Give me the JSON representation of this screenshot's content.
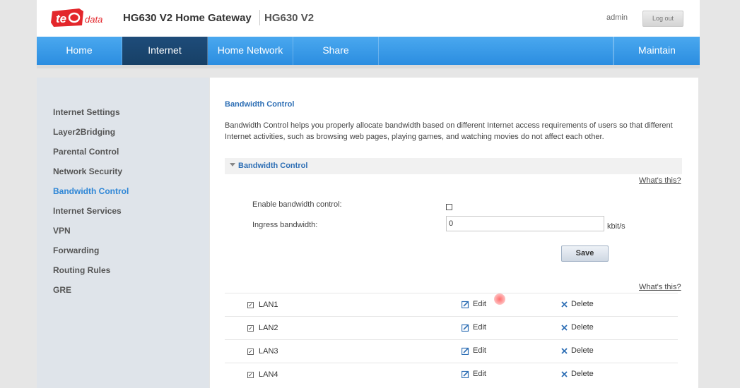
{
  "header": {
    "logo_text": "te data",
    "app_title": "HG630 V2 Home Gateway",
    "model": "HG630 V2",
    "user": "admin",
    "logout_label": "Log out"
  },
  "nav": {
    "tabs": [
      {
        "label": "Home"
      },
      {
        "label": "Internet"
      },
      {
        "label": "Home Network"
      },
      {
        "label": "Share"
      },
      {
        "label": "Maintain"
      }
    ],
    "active": "Internet"
  },
  "sidebar": {
    "items": [
      {
        "label": "Internet Settings"
      },
      {
        "label": "Layer2Bridging"
      },
      {
        "label": "Parental Control"
      },
      {
        "label": "Network Security"
      },
      {
        "label": "Bandwidth Control"
      },
      {
        "label": "Internet Services"
      },
      {
        "label": "VPN"
      },
      {
        "label": "Forwarding"
      },
      {
        "label": "Routing Rules"
      },
      {
        "label": "GRE"
      }
    ],
    "active": "Bandwidth Control"
  },
  "content": {
    "title": "Bandwidth Control",
    "description": "Bandwidth Control helps you properly allocate bandwidth based on different Internet access requirements of users so that different Internet activities, such as browsing web pages, playing games, and watching movies do not affect each other.",
    "section_label": "Bandwidth Control",
    "whats_this": "What's this?",
    "enable_label": "Enable bandwidth control:",
    "enable_checked": false,
    "ingress_label": "Ingress bandwidth:",
    "ingress_value": "0",
    "ingress_unit": "kbit/s",
    "save_label": "Save",
    "lan_rows": [
      {
        "name": "LAN1",
        "checked": true,
        "edit": "Edit",
        "delete": "Delete"
      },
      {
        "name": "LAN2",
        "checked": true,
        "edit": "Edit",
        "delete": "Delete"
      },
      {
        "name": "LAN3",
        "checked": true,
        "edit": "Edit",
        "delete": "Delete"
      },
      {
        "name": "LAN4",
        "checked": true,
        "edit": "Edit",
        "delete": "Delete"
      }
    ]
  },
  "colors": {
    "nav_blue": "#3b9be8",
    "nav_active": "#1e4c7a",
    "link_blue": "#2e6fb5",
    "logo_red": "#e3262b"
  }
}
